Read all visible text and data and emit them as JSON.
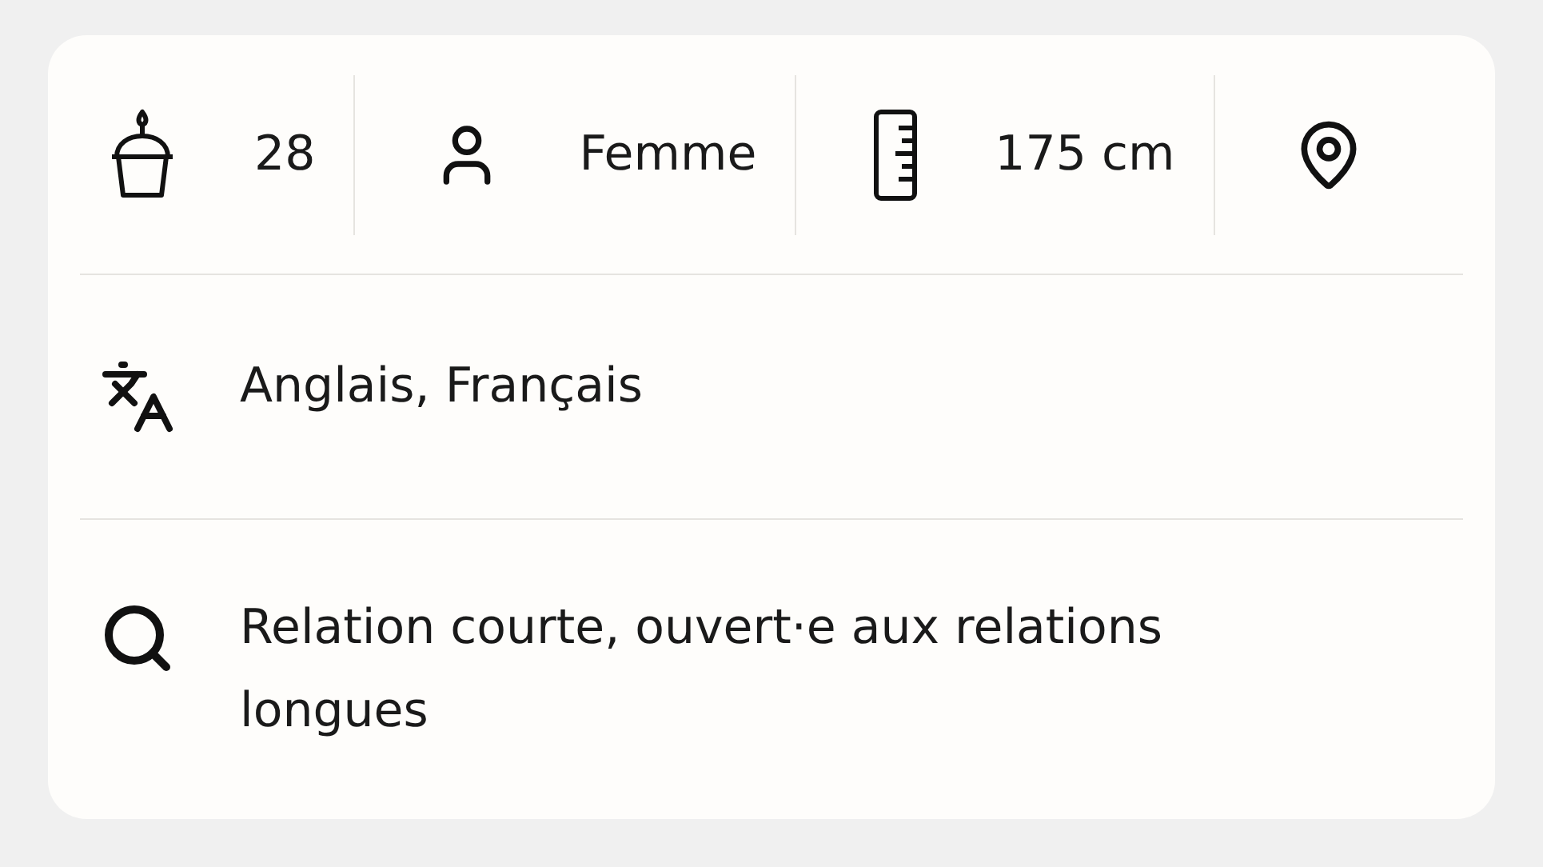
{
  "stats": [
    {
      "kind": "age",
      "text": "28"
    },
    {
      "kind": "gender",
      "text": "Femme"
    },
    {
      "kind": "height",
      "text": "175 cm"
    },
    {
      "kind": "location"
    }
  ],
  "rows": [
    {
      "kind": "languages",
      "text": "Anglais, Français"
    },
    {
      "kind": "looking_for",
      "text": "Relation courte, ouvert·e aux relations longues"
    }
  ]
}
